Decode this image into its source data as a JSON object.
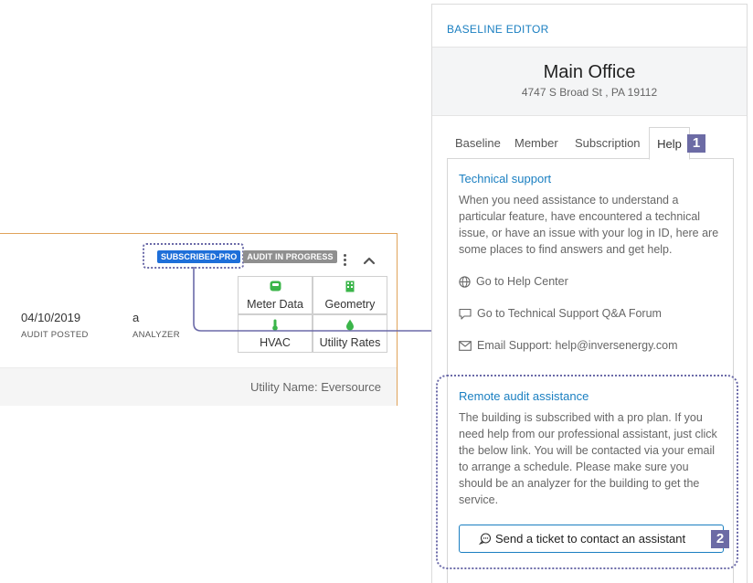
{
  "card": {
    "badge_subscribed": "SUBSCRIBED-PRO",
    "badge_audit": "AUDIT IN PROGRESS",
    "audit_posted_value": "04/10/2019",
    "audit_posted_label": "AUDIT POSTED",
    "analyzer_value": "a",
    "analyzer_label": "ANALYZER",
    "tiles": {
      "meter_data": "Meter Data",
      "geometry": "Geometry",
      "hvac": "HVAC",
      "utility_rates": "Utility Rates"
    },
    "utility_name": "Utility Name: Eversource",
    "icon_color": "#3bb54a",
    "border_color": "#e0a35a"
  },
  "panel": {
    "title": "BASELINE EDITOR",
    "building_name": "Main Office",
    "building_address": "4747 S Broad St , PA 19112",
    "tabs": [
      "Baseline",
      "Member",
      "Subscription",
      "Help"
    ],
    "active_tab": "Help",
    "step_badge_1": "1",
    "technical_support": {
      "title": "Technical support",
      "text": "When you need assistance to understand a particular feature, have encountered a technical issue, or have an issue with your log in ID, here are some places to find answers and get help.",
      "help_center": "Go to Help Center",
      "forum": "Go to Technical Support Q&A Forum",
      "email": "Email Support: help@inversenergy.com"
    },
    "remote_assistance": {
      "title": "Remote audit assistance",
      "text": "The building is subscribed with a pro plan. If you need help from our professional assistant, just click the below link. You will be contacted via your email to arrange a schedule. Please make sure you should be an analyzer for the building to get the service.",
      "button_label": "Send a ticket to contact an assistant",
      "step_badge_2": "2"
    },
    "accent_color": "#1a7fc1",
    "annotation_color": "#6c6ba5"
  }
}
